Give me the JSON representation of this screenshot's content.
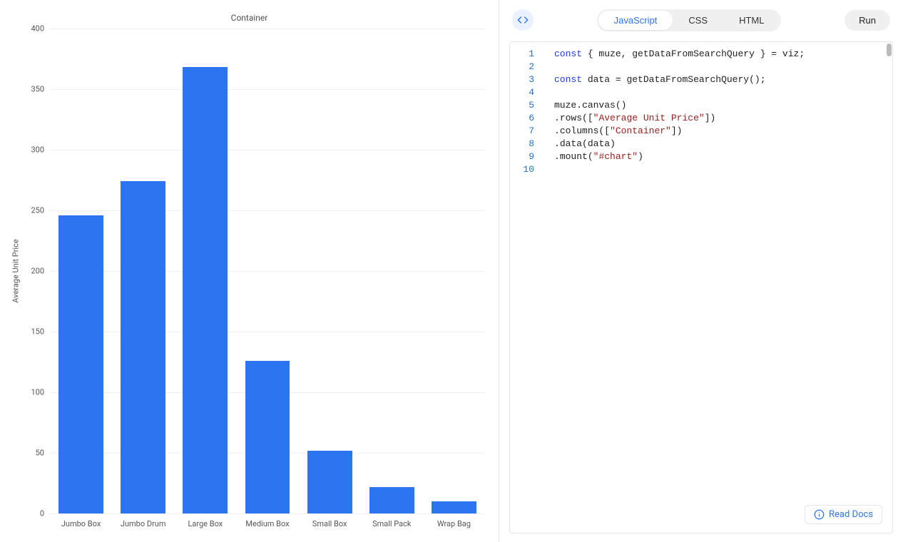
{
  "chart_data": {
    "type": "bar",
    "title": "Container",
    "ylabel": "Average Unit Price",
    "xlabel": "",
    "categories": [
      "Jumbo Box",
      "Jumbo Drum",
      "Large Box",
      "Medium Box",
      "Small Box",
      "Small Pack",
      "Wrap Bag"
    ],
    "values": [
      246,
      274,
      368,
      126,
      52,
      22,
      10
    ],
    "ylim": [
      0,
      400
    ],
    "yticks": [
      0,
      50,
      100,
      150,
      200,
      250,
      300,
      350,
      400
    ]
  },
  "tabs": {
    "javascript": "JavaScript",
    "css": "CSS",
    "html": "HTML",
    "active": "javascript"
  },
  "buttons": {
    "run": "Run",
    "docs": "Read Docs"
  },
  "icons": {
    "code_toggle": "code-icon",
    "info": "info-icon"
  },
  "code": {
    "lines": [
      [
        {
          "t": "kw",
          "v": "const"
        },
        {
          "t": "pn",
          "v": " { "
        },
        {
          "t": "id",
          "v": "muze"
        },
        {
          "t": "pn",
          "v": ", "
        },
        {
          "t": "id",
          "v": "getDataFromSearchQuery"
        },
        {
          "t": "pn",
          "v": " } = "
        },
        {
          "t": "id",
          "v": "viz"
        },
        {
          "t": "pn",
          "v": ";"
        }
      ],
      [],
      [
        {
          "t": "kw",
          "v": "const"
        },
        {
          "t": "pn",
          "v": " "
        },
        {
          "t": "id",
          "v": "data"
        },
        {
          "t": "pn",
          "v": " = "
        },
        {
          "t": "id",
          "v": "getDataFromSearchQuery"
        },
        {
          "t": "pn",
          "v": "();"
        }
      ],
      [],
      [
        {
          "t": "id",
          "v": "muze"
        },
        {
          "t": "pn",
          "v": "."
        },
        {
          "t": "id",
          "v": "canvas"
        },
        {
          "t": "pn",
          "v": "()"
        }
      ],
      [
        {
          "t": "pn",
          "v": "."
        },
        {
          "t": "id",
          "v": "rows"
        },
        {
          "t": "pn",
          "v": "(["
        },
        {
          "t": "str",
          "v": "\"Average Unit Price\""
        },
        {
          "t": "pn",
          "v": "])"
        }
      ],
      [
        {
          "t": "pn",
          "v": "."
        },
        {
          "t": "id",
          "v": "columns"
        },
        {
          "t": "pn",
          "v": "(["
        },
        {
          "t": "str",
          "v": "\"Container\""
        },
        {
          "t": "pn",
          "v": "])"
        }
      ],
      [
        {
          "t": "pn",
          "v": "."
        },
        {
          "t": "id",
          "v": "data"
        },
        {
          "t": "pn",
          "v": "("
        },
        {
          "t": "id",
          "v": "data"
        },
        {
          "t": "pn",
          "v": ")"
        }
      ],
      [
        {
          "t": "pn",
          "v": "."
        },
        {
          "t": "id",
          "v": "mount"
        },
        {
          "t": "pn",
          "v": "("
        },
        {
          "t": "str",
          "v": "\"#chart\""
        },
        {
          "t": "pn",
          "v": ")"
        }
      ],
      []
    ]
  }
}
